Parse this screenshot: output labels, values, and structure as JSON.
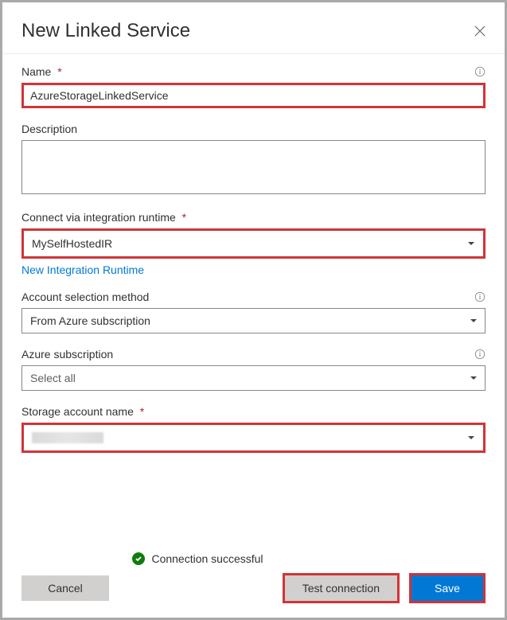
{
  "dialog": {
    "title": "New Linked Service"
  },
  "fields": {
    "name": {
      "label": "Name",
      "required": "*",
      "value": "AzureStorageLinkedService"
    },
    "description": {
      "label": "Description",
      "value": ""
    },
    "runtime": {
      "label": "Connect via integration runtime",
      "required": "*",
      "value": "MySelfHostedIR",
      "new_link": "New Integration Runtime"
    },
    "acct_method": {
      "label": "Account selection method",
      "value": "From Azure subscription"
    },
    "subscription": {
      "label": "Azure subscription",
      "value": "Select all"
    },
    "storage": {
      "label": "Storage account name",
      "required": "*"
    }
  },
  "status": {
    "text": "Connection successful"
  },
  "buttons": {
    "cancel": "Cancel",
    "test": "Test connection",
    "save": "Save"
  }
}
